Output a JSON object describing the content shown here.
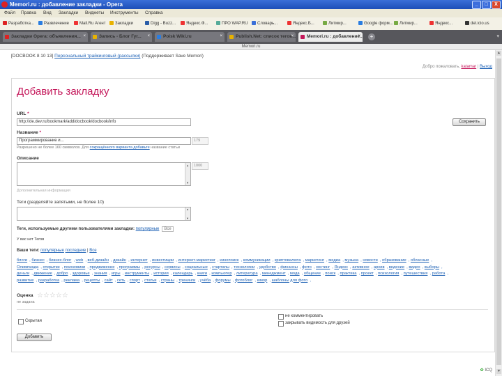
{
  "window": {
    "title": "Memori.ru : добавление закладки - Opera",
    "controls": [
      "_",
      "□",
      "X"
    ]
  },
  "menubar": {
    "items": [
      "Файл",
      "Правка",
      "Вид",
      "Закладки",
      "Виджеты",
      "Инструменты",
      "Справка"
    ]
  },
  "bookmarks": [
    {
      "label": "Разработка...",
      "color": "#d22"
    },
    {
      "label": "Развлечение",
      "color": "#2a7de1"
    },
    {
      "label": "Mail.Ru Агент",
      "color": "#e33"
    },
    {
      "label": "Закладки",
      "color": "#e8b200"
    },
    {
      "label": "Digg - Buzz...",
      "color": "#2a5da8"
    },
    {
      "label": "Яндекс.Ф...",
      "color": "#e33"
    },
    {
      "label": "ПРО WAP.RU",
      "color": "#5a9"
    },
    {
      "label": "Словарь...",
      "color": "#3a6fd8"
    },
    {
      "label": "Яндекс.Б...",
      "color": "#e33"
    },
    {
      "label": "Литмир...",
      "color": "#7a4"
    },
    {
      "label": "Google форм...",
      "color": "#2a7de1"
    },
    {
      "label": "Литмир...",
      "color": "#7a4"
    },
    {
      "label": "Яндекс...",
      "color": "#e33"
    },
    {
      "label": "del.icio.us",
      "color": "#333"
    }
  ],
  "tabs": [
    {
      "label": "Закладки Opera: объявления...",
      "color": "#d22",
      "active": false
    },
    {
      "label": "Запись - Блог Гуг...",
      "color": "#e8b200",
      "active": false
    },
    {
      "label": "Poisk Wiki.ru",
      "color": "#2a7de1",
      "active": false
    },
    {
      "label": "Publish.Net: список тегов...",
      "color": "#e8b200",
      "active": false
    },
    {
      "label": "Memori.ru : добавление...",
      "color": "#c4175a",
      "active": true
    }
  ],
  "page_caption": "Memori.ru",
  "breadcrumb": {
    "prefix": "[DOCBOOK 8 10 13]",
    "link": "Персональный трайкинговый (рассылки)",
    "suffix": "(Поддерживает Save Memori)"
  },
  "userline": {
    "greeting": "Добро пожаловать,",
    "username": "katamar",
    "exit": "Выход"
  },
  "form": {
    "title": "Добавить закладку",
    "url_label": "URL",
    "url_value": "http://de.dev.ru/bookmark/add/docbook/docbook/info",
    "name_label": "Название",
    "name_value": "Программирование и...",
    "name_counter": "179",
    "name_hint_prefix": "Разрешено не более 160 символов. Для ",
    "name_hint_link": "сокращённого варианта добавьте",
    "name_hint_suffix": " название статьи",
    "desc_label": "Описание",
    "desc_counter": "1000",
    "desc_hint": "Дополнительная информация",
    "tags_label": "Теги (разделяйте запятыми, не более 10)",
    "save_button": "Сохранить",
    "used_tags_prefix": "Теги, используемые другими пользователями закладки: ",
    "used_tags_link": "популярные",
    "used_tags_btn": "Все",
    "no_tags_text": "У вас нет Тегов",
    "your_tags_prefix": "Ваши теги: ",
    "your_tags_link1": "популярные",
    "your_tags_link2": "последние",
    "your_tags_btn": "Все",
    "tag_cloud": [
      "блоги",
      "бизнес",
      "бизнес-блог",
      "web",
      "веб-дизайн",
      "дизайн",
      "интернет",
      "инвестиции",
      "интернет-маркетинг",
      "кинопоиск",
      "коммуникации",
      "криптовалюта",
      "маркетинг",
      "медиа",
      "музыка",
      "новости",
      "образование",
      "облачные",
      "Олимпиада",
      "открытки",
      "поисковики",
      "продвижение",
      "программы",
      "ресурсы",
      "сервисы",
      "социальные",
      "стартапы",
      "технологии",
      "удобство",
      "финансы",
      "фото",
      "хостинг",
      "Яндекс",
      "активное",
      "архив",
      "ведение",
      "видео",
      "выборы",
      "деньги",
      "движение",
      "добро",
      "здоровье",
      "знания",
      "игры",
      "инструменты",
      "история",
      "календарь",
      "книги",
      "компьютер",
      "литература",
      "менеджмент",
      "мода",
      "общение",
      "поиск",
      "практика",
      "проект",
      "психология",
      "путешествия",
      "работа",
      "развитие",
      "разработка",
      "реклама",
      "рецепты",
      "сайт",
      "сеть",
      "спорт",
      "статьи",
      "страны",
      "тренинги",
      "учёба",
      "форумы",
      "фотоблог",
      "юмор",
      "шаблоны для фото"
    ],
    "rating_label": "Оценка",
    "rating_value": 0,
    "rating_max": 5,
    "rating_sub": "не задана",
    "private_label": "Скрытая",
    "no_comments_label": "не комментировать",
    "friends_only_label": "закрывать видимость для друзей",
    "submit_button": "Добавить"
  },
  "footer": {
    "logo_text": "ICQ"
  }
}
